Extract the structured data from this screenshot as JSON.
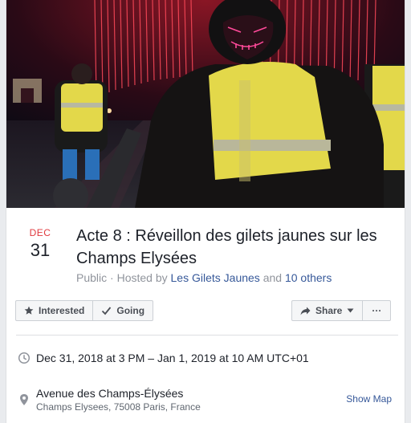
{
  "event": {
    "date": {
      "month": "DEC",
      "day": "31"
    },
    "title": "Acte 8 : Réveillon des gilets jaunes sur les Champs Elysées",
    "privacy": "Public",
    "hosted_prefix": " · Hosted by ",
    "host": "Les Gilets Jaunes",
    "and_text": " and ",
    "others": "10 others"
  },
  "actions": {
    "interested_label": "Interested",
    "going_label": "Going",
    "share_label": "Share",
    "more_label": "···"
  },
  "details": {
    "datetime": "Dec 31, 2018 at 3 PM – Jan 1, 2019 at 10 AM UTC+01",
    "location_name": "Avenue des Champs-Élysées",
    "location_address": "Champs Elysees, 75008 Paris, France",
    "show_map_label": "Show Map"
  },
  "colors": {
    "month": "#e0393e",
    "link": "#365899",
    "vest": "#e3d84a",
    "lights": "#ff4a5a"
  },
  "icons": [
    "star-icon",
    "check-icon",
    "share-arrow-icon",
    "caret-down-icon",
    "clock-icon",
    "map-pin-icon"
  ]
}
